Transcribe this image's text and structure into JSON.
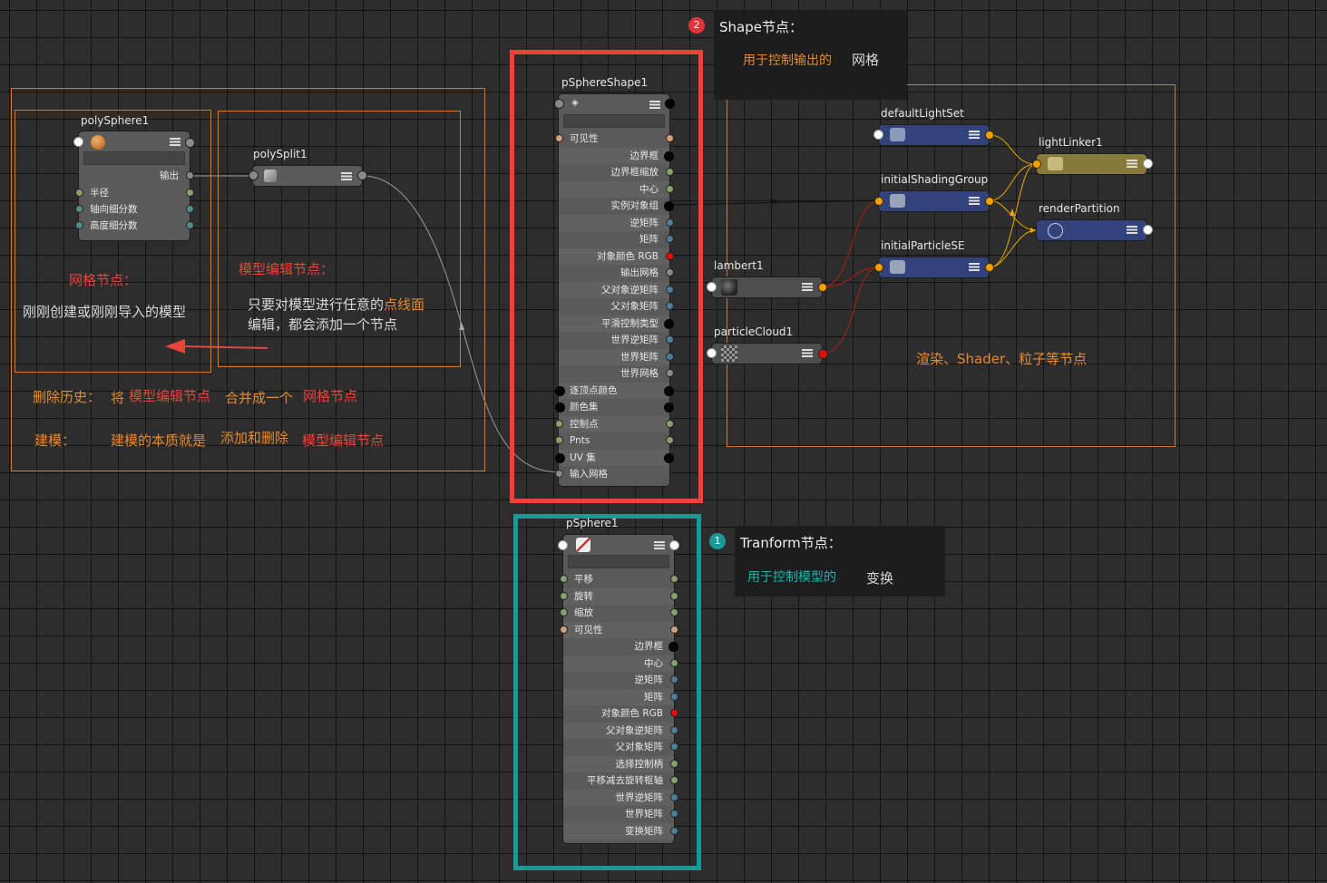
{
  "nodes": {
    "polySphere": {
      "title": "polySphere1",
      "output": "输出",
      "attrs": [
        "半径",
        "轴向细分数",
        "高度细分数"
      ]
    },
    "polySplit": {
      "title": "polySplit1"
    },
    "shape": {
      "title": "pSphereShape1",
      "attrs": [
        "可见性",
        "边界框",
        "边界框缩放",
        "中心",
        "实例对象组",
        "逆矩阵",
        "矩阵",
        "对象颜色 RGB",
        "输出网格",
        "父对象逆矩阵",
        "父对象矩阵",
        "平滑控制类型",
        "世界逆矩阵",
        "世界矩阵",
        "世界网格",
        "逐顶点颜色",
        "颜色集",
        "控制点",
        "Pnts",
        "UV 集",
        "输入网格"
      ]
    },
    "transform": {
      "title": "pSphere1",
      "attrs": [
        "平移",
        "旋转",
        "缩放",
        "可见性",
        "边界框",
        "中心",
        "逆矩阵",
        "矩阵",
        "对象颜色 RGB",
        "父对象逆矩阵",
        "父对象矩阵",
        "选择控制柄",
        "平移减去旋转枢轴",
        "世界逆矩阵",
        "世界矩阵",
        "变换矩阵"
      ]
    },
    "defaultLightSet": "defaultLightSet",
    "initialShadingGroup": "initialShadingGroup",
    "initialParticleSE": "initialParticleSE",
    "lightLinker": "lightLinker1",
    "renderPartition": "renderPartition",
    "lambert": "lambert1",
    "particleCloud": "particleCloud1"
  },
  "annotations": {
    "mesh_title": "网格节点：",
    "mesh_desc": "刚刚创建或刚刚导入的模型",
    "edit_title": "模型编辑节点：",
    "edit_desc1_a": "只要对模型进行任意的",
    "edit_desc1_b": "点线面",
    "edit_desc2": "编辑，都会添加一个节点",
    "delete_label": "删除历史：",
    "delete_a": "将",
    "delete_b": "模型编辑节点",
    "delete_c": "合并成一个",
    "delete_d": "网格节点",
    "model_label": "建模：",
    "model_a": "建模的本质就是",
    "model_b": "添加和删除",
    "model_c": "模型编辑节点",
    "render_note": "渲染、Shader、粒子等节点"
  },
  "tips": {
    "shape": {
      "badge": "2",
      "title": "Shape节点：",
      "desc_a": "用于控制输出的",
      "desc_b": "网格"
    },
    "transform": {
      "badge": "1",
      "title": "Tranform节点：",
      "desc_a": "用于控制模型的",
      "desc_b": "变换"
    }
  },
  "colors": {
    "highlight_red": "#e8443a",
    "highlight_teal": "#1a9a96",
    "frame_orange": "#d07a2a",
    "shading_group": "#32437c",
    "light_linker": "#8a7a3a"
  }
}
